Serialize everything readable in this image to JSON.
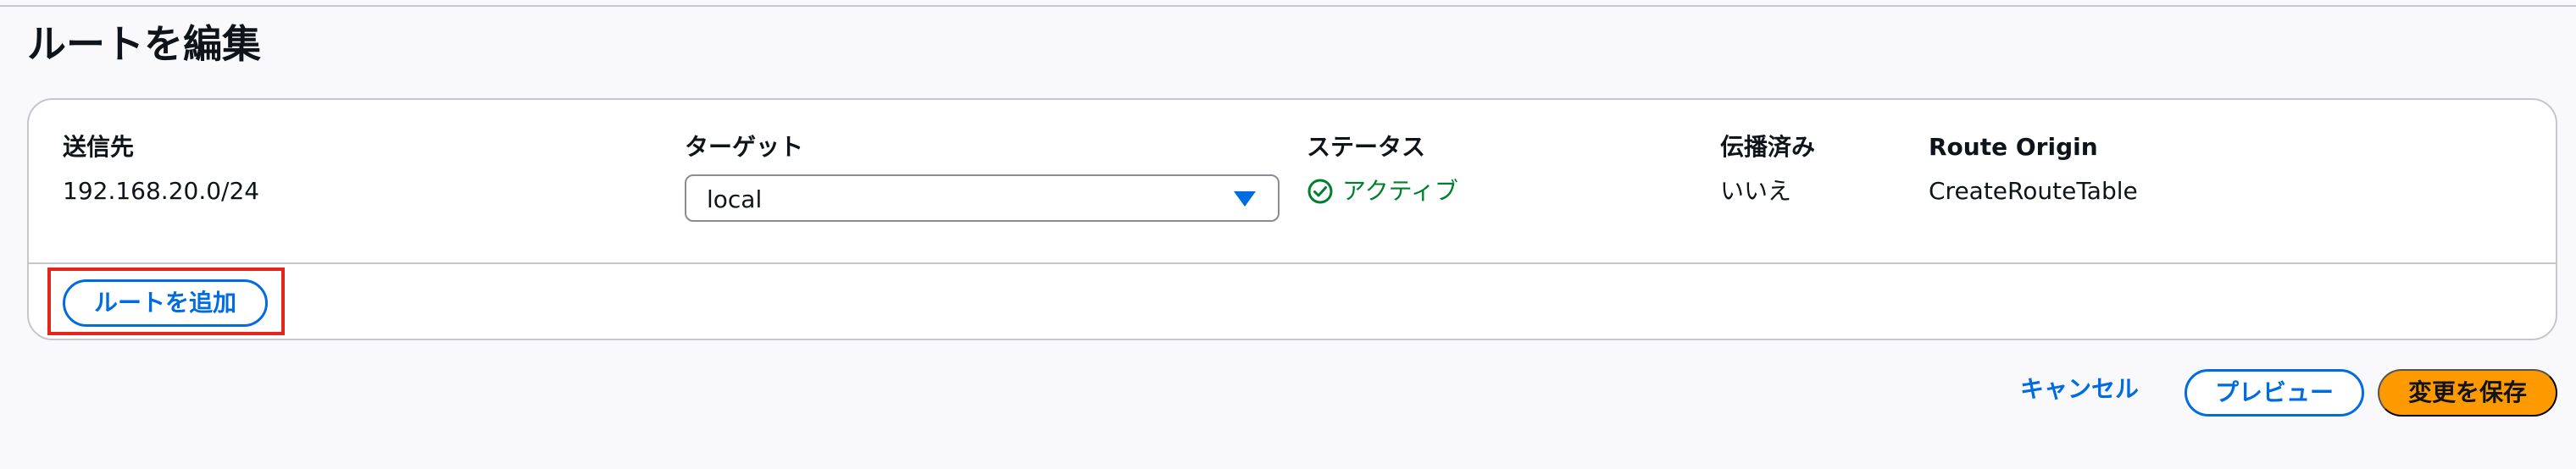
{
  "page": {
    "title": "ルートを編集"
  },
  "table": {
    "headers": {
      "destination": "送信先",
      "target": "ターゲット",
      "status": "ステータス",
      "propagated": "伝播済み",
      "route_origin": "Route Origin"
    },
    "rows": [
      {
        "destination": "192.168.20.0/24",
        "target": "local",
        "status": "アクティブ",
        "propagated": "いいえ",
        "route_origin": "CreateRouteTable"
      }
    ]
  },
  "actions": {
    "add_route": "ルートを追加",
    "cancel": "キャンセル",
    "preview": "プレビュー",
    "save": "変更を保存"
  },
  "colors": {
    "link": "#006ce0",
    "status_success": "#00802f",
    "primary_button": "#ff9900",
    "highlight": "#e2261c"
  },
  "icons": {
    "status": "check-circle-icon",
    "select": "caret-down-icon"
  }
}
